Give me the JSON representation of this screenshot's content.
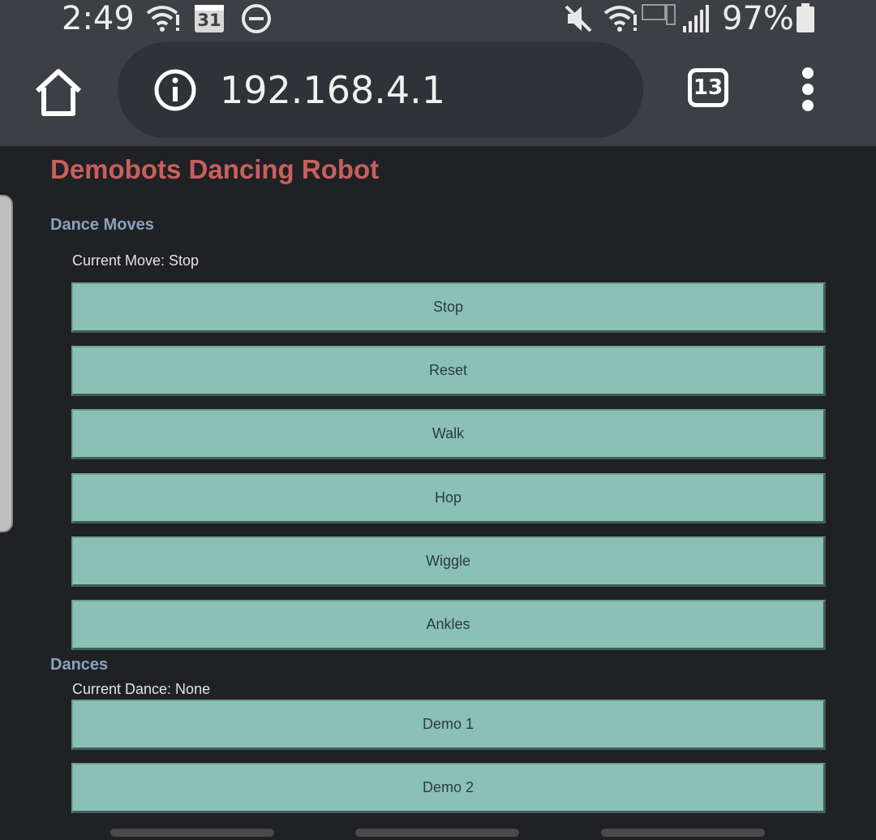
{
  "status_bar": {
    "time": "2:49",
    "calendar_day": "31",
    "battery_percent": "97%",
    "icons": [
      "wifi-alert-icon",
      "calendar-icon",
      "do-not-disturb-icon",
      "mute-icon",
      "wifi-alert-icon",
      "lte-icon",
      "signal-icon",
      "battery-icon"
    ]
  },
  "browser": {
    "url": "192.168.4.1",
    "tab_count": "13",
    "icons": [
      "home-icon",
      "info-icon",
      "tabs-icon",
      "more-vert-icon"
    ]
  },
  "page": {
    "title": "Demobots Dancing Robot",
    "dance_moves": {
      "heading": "Dance Moves",
      "current_label": "Current Move: Stop",
      "buttons": [
        "Stop",
        "Reset",
        "Walk",
        "Hop",
        "Wiggle",
        "Ankles"
      ]
    },
    "dances": {
      "heading": "Dances",
      "current_label": "Current Dance: None",
      "buttons": [
        "Demo 1",
        "Demo 2"
      ]
    }
  },
  "colors": {
    "title": "#c9605d",
    "heading": "#89a3bf",
    "button_bg": "#8bc0b6",
    "page_bg": "#202124",
    "chrome_bg": "#3c3f43"
  }
}
